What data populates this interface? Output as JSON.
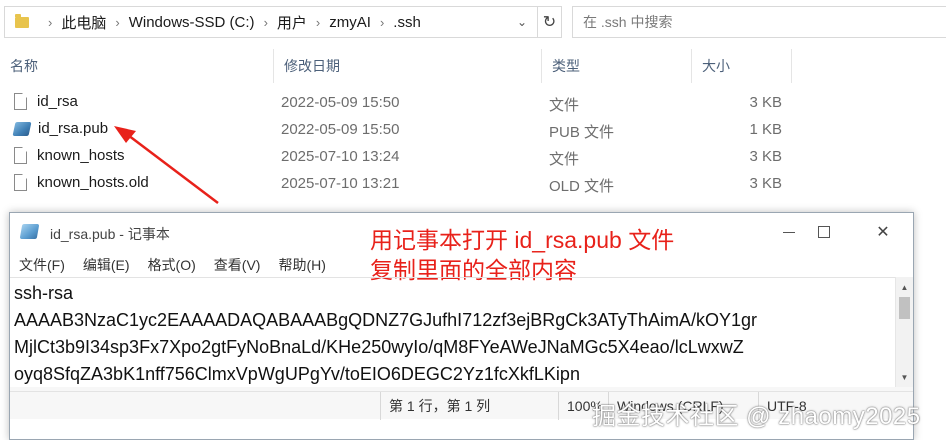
{
  "explorer": {
    "breadcrumb": [
      "此电脑",
      "Windows-SSD (C:)",
      "用户",
      "zmyAI",
      ".ssh"
    ],
    "search_placeholder": "在 .ssh 中搜索",
    "columns": {
      "name": "名称",
      "date": "修改日期",
      "type": "类型",
      "size": "大小"
    },
    "files": [
      {
        "name": "id_rsa",
        "date": "2022-05-09 15:50",
        "type": "文件",
        "size": "3 KB",
        "icon": "document-icon"
      },
      {
        "name": "id_rsa.pub",
        "date": "2022-05-09 15:50",
        "type": "PUB 文件",
        "size": "1 KB",
        "icon": "pub-file-icon"
      },
      {
        "name": "known_hosts",
        "date": "2025-07-10 13:24",
        "type": "文件",
        "size": "3 KB",
        "icon": "document-icon"
      },
      {
        "name": "known_hosts.old",
        "date": "2025-07-10 13:21",
        "type": "OLD 文件",
        "size": "3 KB",
        "icon": "document-icon"
      }
    ]
  },
  "notepad": {
    "title": "id_rsa.pub - 记事本",
    "menu": [
      "文件(F)",
      "编辑(E)",
      "格式(O)",
      "查看(V)",
      "帮助(H)"
    ],
    "content_lines": [
      "ssh-rsa",
      "AAAAB3NzaC1yc2EAAAADAQABAAABgQDNZ7GJufhI712zf3ejBRgCk3ATyThAimA/kOY1gr",
      "MjlCt3b9I34sp3Fx7Xpo2gtFyNoBnaLd/KHe250wyIo/qM8FYeAWeJNaMGc5X4eao/lcLwxwZ",
      "oyq8SfqZA3bK1nff756ClmxVpWgUPgYv/toEIO6DEGC2Yz1fcXkfLKipn"
    ],
    "status": {
      "position": "第 1 行，第 1 列",
      "zoom": "100%",
      "line_ending": "Windows (CRLF)",
      "encoding": "UTF-8"
    }
  },
  "annotation": {
    "line1": "用记事本打开 id_rsa.pub 文件",
    "line2": "复制里面的全部内容",
    "color": "#e8211a"
  },
  "watermark": "掘金技术社区 @ zhaomy2025"
}
